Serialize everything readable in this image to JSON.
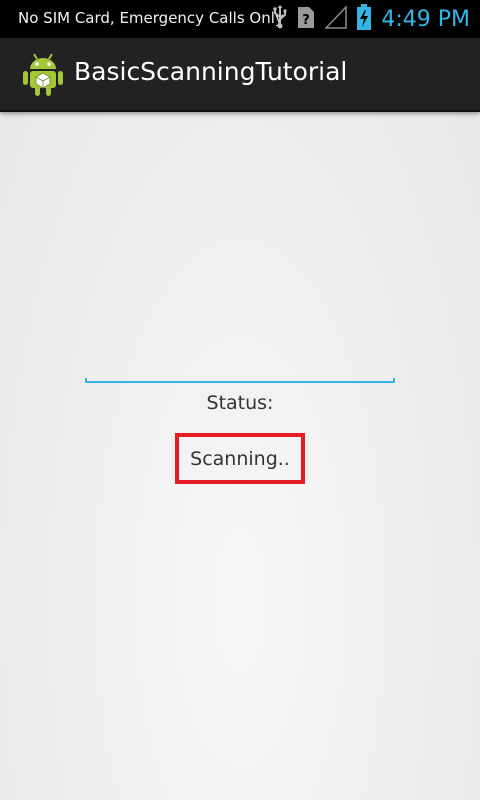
{
  "status_bar": {
    "carrier_text": "No SIM Card, Emergency Calls Only",
    "time": "4:49 PM",
    "icons": [
      "usb-icon",
      "sim-missing-icon",
      "signal-icon",
      "battery-charging-icon"
    ],
    "time_color": "#33b5e5"
  },
  "action_bar": {
    "title": "BasicScanningTutorial",
    "app_icon": "android-robot-icon",
    "background_color": "#222222"
  },
  "main": {
    "input": {
      "value": "",
      "placeholder": "",
      "underline_color": "#33b5e5"
    },
    "status_label": "Status:",
    "status_value": "Scanning..",
    "highlight_color": "#e31b23"
  }
}
